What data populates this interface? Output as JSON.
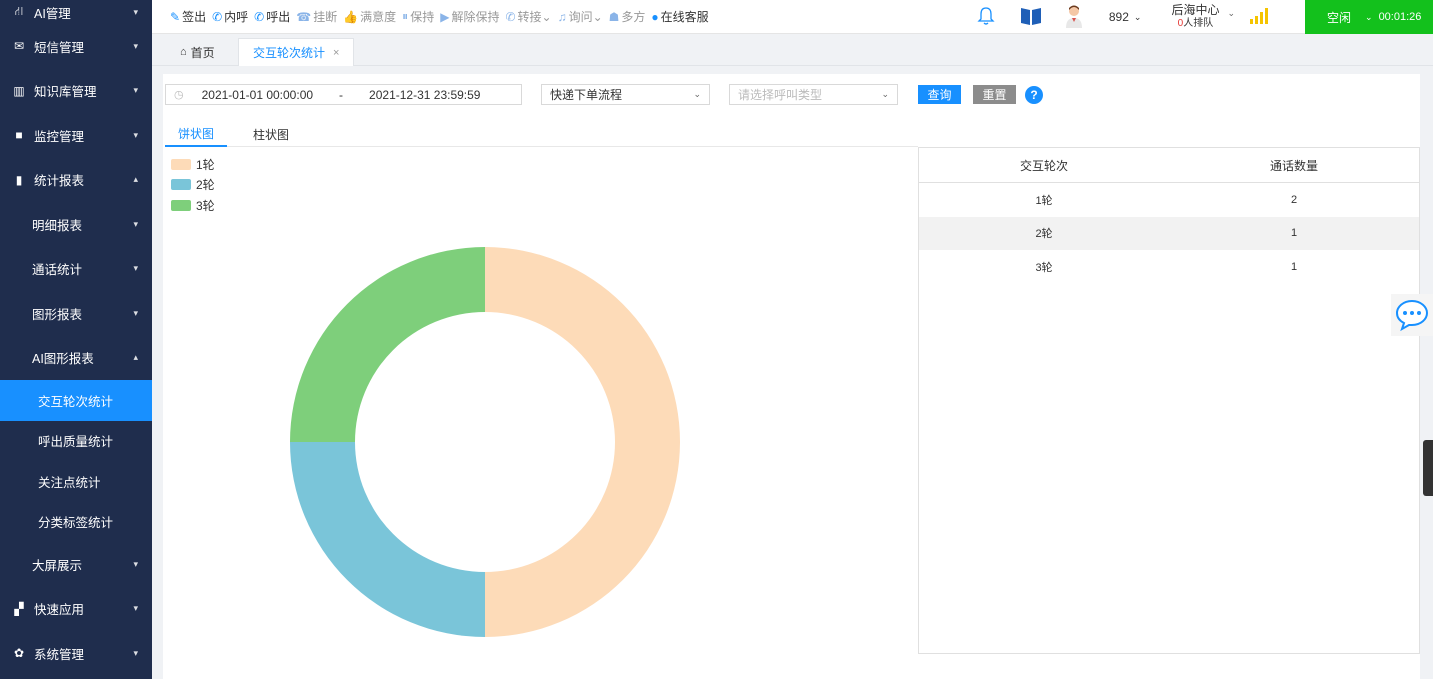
{
  "sidebar": {
    "items": [
      {
        "icon": "ai-icon",
        "glyph": "⛙",
        "label": "AI管理",
        "chev": "▾"
      },
      {
        "icon": "mail-icon",
        "glyph": "✉",
        "label": "短信管理",
        "chev": "▾"
      },
      {
        "icon": "book-icon",
        "glyph": "▥",
        "label": "知识库管理",
        "chev": "▾"
      },
      {
        "icon": "camera-icon",
        "glyph": "■",
        "label": "监控管理",
        "chev": "▾"
      },
      {
        "icon": "bar-chart-icon",
        "glyph": "▮",
        "label": "统计报表",
        "chev": "▴"
      }
    ],
    "sub_items": [
      {
        "label": "明细报表",
        "chev": "▾"
      },
      {
        "label": "通话统计",
        "chev": "▾"
      },
      {
        "label": "图形报表",
        "chev": "▾"
      },
      {
        "label": "AI图形报表",
        "chev": "▴"
      }
    ],
    "leaf_items": [
      "交互轮次统计",
      "呼出质量统计",
      "关注点统计",
      "分类标签统计"
    ],
    "bottom_items": [
      {
        "label": "大屏展示",
        "chev": "▾"
      },
      {
        "icon": "apps-icon",
        "glyph": "▞",
        "label": "快速应用",
        "chev": "▾"
      },
      {
        "icon": "gear-icon",
        "glyph": "✿",
        "label": "系统管理",
        "chev": "▾"
      }
    ]
  },
  "topbar": {
    "buttons": [
      {
        "name": "sign-out-button",
        "glyph": "✎",
        "label": "签出",
        "style": "dark"
      },
      {
        "name": "internal-call-button",
        "glyph": "✆",
        "label": "内呼",
        "style": "dark"
      },
      {
        "name": "outbound-call-button",
        "glyph": "✆",
        "label": "呼出",
        "style": "dark"
      },
      {
        "name": "hangup-button",
        "glyph": "☎",
        "label": "挂断",
        "style": "gray"
      },
      {
        "name": "satisfaction-button",
        "glyph": "👍",
        "label": "满意度",
        "style": "gray"
      },
      {
        "name": "hold-button",
        "glyph": "⏸",
        "label": "保持",
        "style": "gray"
      },
      {
        "name": "unhold-button",
        "glyph": "▶",
        "label": "解除保持",
        "style": "gray"
      },
      {
        "name": "transfer-button",
        "glyph": "✆",
        "label": "转接⌄",
        "style": "gray"
      },
      {
        "name": "consult-button",
        "glyph": "♫",
        "label": "询问⌄",
        "style": "gray"
      },
      {
        "name": "multiparty-button",
        "glyph": "☗",
        "label": "多方",
        "style": "gray"
      },
      {
        "name": "online-service-button",
        "glyph": "●",
        "label": "在线客服",
        "style": "dark"
      }
    ],
    "extension": "892",
    "center_name": "后海中心",
    "queue_count": "0",
    "queue_label": "人排队",
    "status": "空闲",
    "timer": "00:01:26"
  },
  "tabs": {
    "home": "首页",
    "active": "交互轮次统计",
    "close": "×"
  },
  "filters": {
    "date_start": "2021-01-01 00:00:00",
    "date_sep": "-",
    "date_end": "2021-12-31 23:59:59",
    "flow_value": "快递下单流程",
    "call_type_placeholder": "请选择呼叫类型",
    "query_label": "查询",
    "reset_label": "重置",
    "help": "?"
  },
  "view_tabs": {
    "pie": "饼状图",
    "bar": "柱状图"
  },
  "colors": {
    "round1": "#fddbb8",
    "round2": "#7ac5d9",
    "round3": "#7ecf7b",
    "accent": "#1890ff",
    "sidebar_bg": "#1f2d4d",
    "status_green": "#13c11c"
  },
  "table": {
    "headers": [
      "交互轮次",
      "通话数量"
    ],
    "rows": [
      [
        "1轮",
        "2"
      ],
      [
        "2轮",
        "1"
      ],
      [
        "3轮",
        "1"
      ]
    ]
  },
  "chart_data": {
    "type": "pie",
    "variant": "donut",
    "categories": [
      "1轮",
      "2轮",
      "3轮"
    ],
    "values": [
      2,
      1,
      1
    ],
    "legend_position": "top-left"
  }
}
